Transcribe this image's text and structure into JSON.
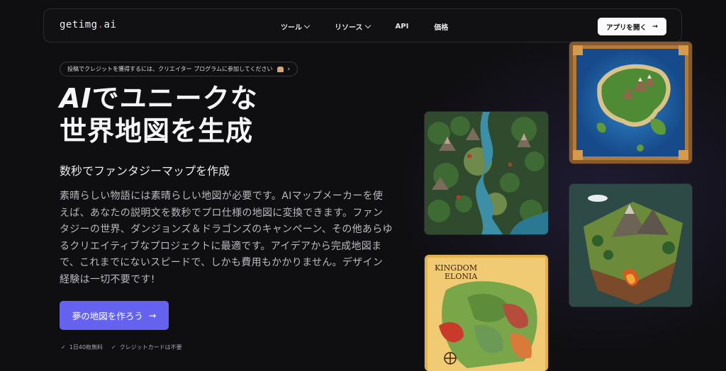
{
  "nav": {
    "logo_text": "getimg",
    "logo_dot": ".",
    "logo_tld": "ai",
    "menu": [
      {
        "label": "ツール",
        "has_dropdown": true
      },
      {
        "label": "リソース",
        "has_dropdown": true
      },
      {
        "label": "API",
        "has_dropdown": false
      },
      {
        "label": "価格",
        "has_dropdown": false
      }
    ],
    "cta_label": "アプリを開く",
    "cta_icon": "arrow-right-icon"
  },
  "hero": {
    "promo_pill": "投稿でクレジットを獲得するには、クリエイター プログラムに参加してください",
    "promo_icon": "hand-emoji-icon",
    "title_ai": "AI",
    "title_line1_rest": "でユニークな",
    "title_line2": "世界地図を生成",
    "subtitle": "数秒でファンタジーマップを作成",
    "description": "素晴らしい物語には素晴らしい地図が必要です。AIマップメーカーを使えば、あなたの説明文を数秒でプロ仕様の地図に変換できます。ファンタジーの世界、ダンジョンズ＆ドラゴンズのキャンペーン、その他あらゆるクリエイティブなプロジェクトに最適です。アイデアから完成地図まで、これまでにないスピードで、しかも費用もかかりません。デザイン経験は一切不要です!",
    "cta_label": "夢の地図を作ろう",
    "checks": [
      "1日40枚無料",
      "クレジットカードは不要"
    ]
  },
  "gallery": {
    "map4_title_line1": "KINGDOM",
    "map4_title_line2": "ELONIA"
  },
  "colors": {
    "background": "#0f0f12",
    "accent": "#6562f0",
    "logo_dot": "#ff4a3d"
  }
}
